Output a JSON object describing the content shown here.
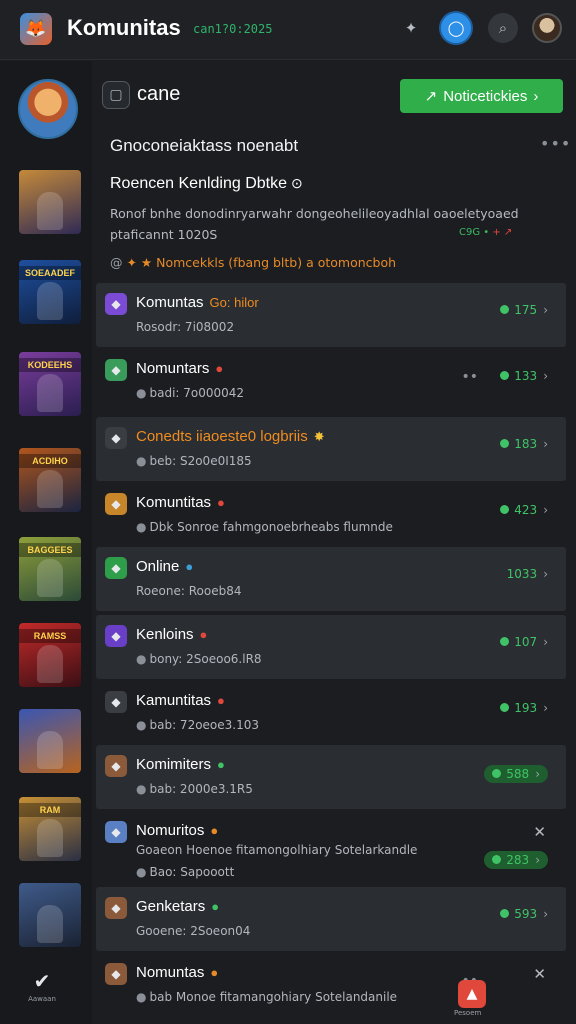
{
  "header": {
    "title": "Komunitas",
    "subtitle": "can1?0:2025",
    "icons": [
      "puzzle-icon",
      "chat-icon",
      "search-icon",
      "avatar"
    ]
  },
  "sidebar": {
    "thumbnails": [
      {
        "banner": "",
        "color_a": "#c58a3a",
        "color_b": "#2f2a55"
      },
      {
        "banner": "SOEAADEF",
        "color_a": "#1e4fa0",
        "color_b": "#0f1e3b"
      },
      {
        "banner": "KODEEHS",
        "color_a": "#7a3d9c",
        "color_b": "#2a1e4f"
      },
      {
        "banner": "ACDIHO",
        "color_a": "#b2561c",
        "color_b": "#1b2440"
      },
      {
        "banner": "BAGGEES",
        "color_a": "#8fa03a",
        "color_b": "#2b4a38"
      },
      {
        "banner": "RAMSS",
        "color_a": "#c32a2a",
        "color_b": "#3a0f14"
      },
      {
        "banner": "",
        "color_a": "#3a56b3",
        "color_b": "#b8641e"
      },
      {
        "banner": "RAM",
        "color_a": "#c79036",
        "color_b": "#2a2f44"
      },
      {
        "banner": "",
        "color_a": "#3f5b8a",
        "color_b": "#1a2233"
      }
    ],
    "bottom_label": "Aawaan"
  },
  "main": {
    "top_label": "cane",
    "notify_button": "Noticetickies",
    "section_title": "Gnoconeiaktass noenabt",
    "feature": {
      "title": "Roencen Kenlding Dbtke",
      "desc_line1": "Ronof bnhe donodinryarwahr dongeohelileoyadhlal oaoeletyoaed",
      "desc_line2": "ptaficannt 1020S",
      "stats": "C9G • ",
      "stats_red": "+ ↗",
      "note": "Nomcekkls (fbang bltb) a otomoncboh"
    },
    "rows": [
      {
        "name": "Komuntas",
        "badge": "Go: hilor",
        "badge_color": "#f08c1e",
        "sub": "Rosodr: 7i08002",
        "sub_icon": "",
        "count": "175",
        "av_color": "#7b4bd6",
        "alt": true,
        "pill": false,
        "close": false,
        "orange": false
      },
      {
        "name": "Nomuntars",
        "badge": "●",
        "badge_color": "#e0483b",
        "sub": "badi: 7o000042",
        "sub_icon": "●",
        "count": "133",
        "av_color": "#3a9c5a",
        "alt": false,
        "pill": false,
        "close": false,
        "orange": false,
        "dots": "••"
      },
      {
        "name": "Conedts iiaoeste0 logbriis",
        "badge": "✸",
        "badge_color": "#f2c23a",
        "sub": "beb: S2o0e0I185",
        "sub_icon": "●",
        "count": "183",
        "av_color": "#3a3d42",
        "alt": true,
        "pill": false,
        "close": false,
        "orange": true
      },
      {
        "name": "Komuntitas",
        "badge": "●",
        "badge_color": "#e0483b",
        "sub": "Dbk Sonroe fahmgonoebrheabs flumnde",
        "sub_icon": "●",
        "count": "423",
        "av_color": "#c7862a",
        "alt": false,
        "pill": false,
        "close": false,
        "orange": false
      },
      {
        "name": "Online",
        "badge": "●",
        "badge_color": "#3b9fd6",
        "sub": "Roeone: Rooeb84",
        "sub_icon": "",
        "count": "1033",
        "av_color": "#2f9e4a",
        "alt": true,
        "pill": false,
        "close": false,
        "orange": false
      },
      {
        "name": "Kenloins",
        "badge": "●",
        "badge_color": "#e0483b",
        "sub": "bony: 2Soeoo6.lR8",
        "sub_icon": "●",
        "count": "107",
        "av_color": "#6a3fc8",
        "alt": true,
        "pill": false,
        "close": false,
        "orange": false
      },
      {
        "name": "Kamuntitas",
        "badge": "●",
        "badge_color": "#e0483b",
        "sub": "bab: 72oeoe3.103",
        "sub_icon": "●",
        "count": "193",
        "av_color": "#3a3d42",
        "alt": false,
        "pill": false,
        "close": false,
        "orange": false
      },
      {
        "name": "Komimiters",
        "badge": "●",
        "badge_color": "#3fc366",
        "sub": "bab: 2000e3.1R5",
        "sub_icon": "●",
        "count": "588",
        "av_color": "#8a5a3a",
        "alt": true,
        "pill": true,
        "close": false,
        "orange": false
      },
      {
        "name": "Nomuritos",
        "badge": "●",
        "badge_color": "#e68a28",
        "sub": "Bao: Sapooott",
        "sub_icon": "●",
        "count": "283",
        "av_color": "#5a7fc2",
        "alt": false,
        "pill": true,
        "close": true,
        "orange": false,
        "sub2": "Goaeon Hoenoe fitamongolhiary Sotelarkandle"
      },
      {
        "name": "Genketars",
        "badge": "●",
        "badge_color": "#3fc366",
        "sub": "Gooene: 2Soeon04",
        "sub_icon": "",
        "count": "593",
        "av_color": "#8a5a3a",
        "alt": true,
        "pill": false,
        "close": false,
        "orange": false
      },
      {
        "name": "Nomuntas",
        "badge": "●",
        "badge_color": "#e68a28",
        "sub": "bab Monoe fitamangohiary Sotelandanile",
        "sub_icon": "●",
        "count": "",
        "av_color": "#8a5a3a",
        "alt": false,
        "pill": false,
        "close": true,
        "orange": false,
        "dots": "••"
      }
    ],
    "fab_label": "Pesoem"
  },
  "colors": {
    "accent_green": "#2fae4a",
    "accent_blue": "#2d8fe6",
    "accent_red": "#e0483b",
    "accent_orange": "#f08c1e"
  }
}
